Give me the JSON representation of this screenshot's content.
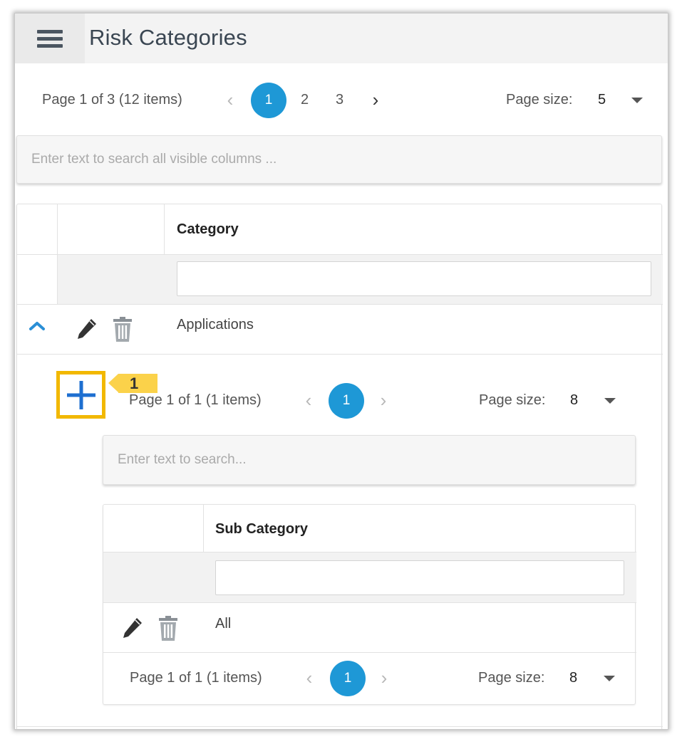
{
  "header": {
    "title": "Risk Categories",
    "menu_icon": "hamburger-menu-icon"
  },
  "main_pager": {
    "summary": "Page 1 of 3 (12 items)",
    "pages": [
      "1",
      "2",
      "3"
    ],
    "current_page": "1",
    "page_size_label": "Page size:",
    "page_size_value": "5"
  },
  "main_search": {
    "placeholder": "Enter text to search all visible columns ..."
  },
  "main_grid": {
    "column_header": "Category",
    "rows": [
      {
        "category": "Applications"
      }
    ]
  },
  "annotation": {
    "label": "1",
    "color": "#fbd24a",
    "highlight": "#f2b800"
  },
  "detail_pager_top": {
    "summary": "Page 1 of 1 (1 items)",
    "current_page": "1",
    "page_size_label": "Page size:",
    "page_size_value": "8"
  },
  "detail_search": {
    "placeholder": "Enter text to search..."
  },
  "detail_grid": {
    "column_header": "Sub Category",
    "rows": [
      {
        "sub_category": "All"
      }
    ]
  },
  "detail_pager_bottom": {
    "summary": "Page 1 of 1 (1 items)",
    "current_page": "1",
    "page_size_label": "Page size:",
    "page_size_value": "8"
  },
  "colors": {
    "accent": "#1e98d6",
    "add_icon": "#1e6fd0",
    "expand_icon": "#2a8fd6"
  },
  "icons": [
    "hamburger-menu-icon",
    "chevron-left-icon",
    "chevron-right-icon",
    "caret-down-icon",
    "chevron-up-icon",
    "pencil-icon",
    "trash-icon",
    "plus-icon"
  ]
}
